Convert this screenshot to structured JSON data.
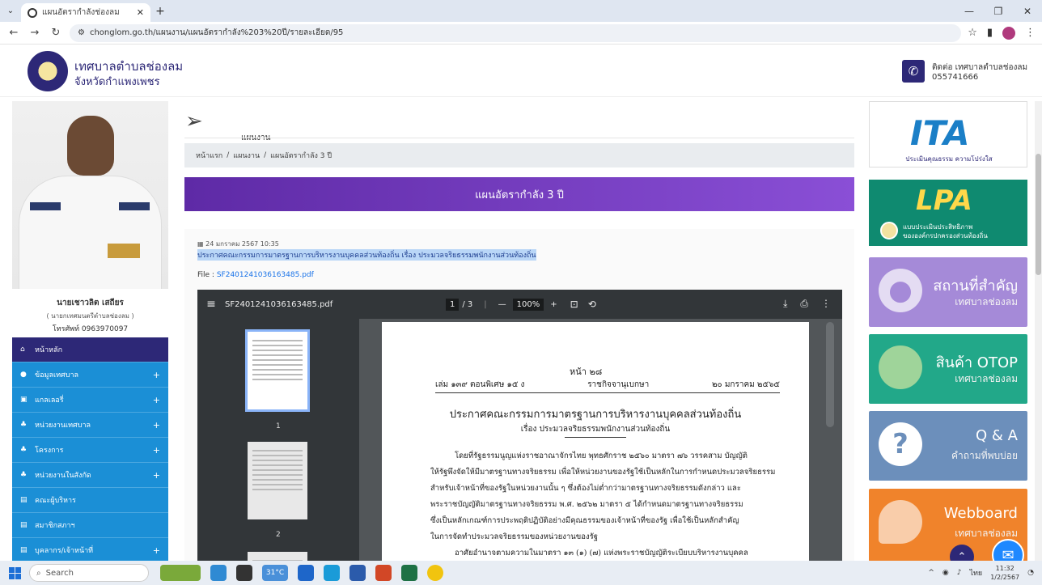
{
  "browser": {
    "tab_title": "แผนอัตรากำลังช่องลม",
    "url": "chonglom.go.th/แผนงาน/แผนอัตรากำลัง%203%20ปี/รายละเอียด/95"
  },
  "header": {
    "site_name": "เทศบาลตำบลช่องลม",
    "province": "จังหวัดกำแพงเพชร",
    "contact_line1": "ติดต่อ เทศบาลตำบลช่องลม",
    "contact_line2": "055741666"
  },
  "mayor": {
    "name": "นายเชาวลิต เสถียร",
    "position": "( นายกเทศมนตรีตำบลช่องลม )",
    "phone": "โทรศัพท์ 0963970097"
  },
  "menu": [
    {
      "icon": "home-icon",
      "label": "หน้าหลัก",
      "plus": ""
    },
    {
      "icon": "info-icon",
      "label": "ข้อมูลเทศบาล",
      "plus": "+"
    },
    {
      "icon": "gallery-icon",
      "label": "แกลเลอรี่",
      "plus": "+"
    },
    {
      "icon": "org-icon",
      "label": "หน่วยงานเทศบาล",
      "plus": "+"
    },
    {
      "icon": "org-icon",
      "label": "โครงการ",
      "plus": "+"
    },
    {
      "icon": "org-icon",
      "label": "หน่วยงานในสังกัด",
      "plus": "+"
    },
    {
      "icon": "card-icon",
      "label": "คณะผู้บริหาร",
      "plus": ""
    },
    {
      "icon": "card-icon",
      "label": "สมาชิกสภาฯ",
      "plus": ""
    },
    {
      "icon": "card-icon",
      "label": "บุคลากร/เจ้าหน้าที่",
      "plus": "+"
    }
  ],
  "content": {
    "section_title": "แผนงาน",
    "breadcrumb": [
      "หน้าแรก",
      "แผนงาน",
      "แผนอัตรากำลัง 3 ปี"
    ],
    "breadcrumb_sep": "/",
    "banner": "แผนอัตรากำลัง 3 ปี",
    "post_date": "24 มกราคม 2567 10:35",
    "post_title": "ประกาศคณะกรรมการมาตรฐานการบริหารงานบุคคลส่วนท้องถิ่น เรื่อง ประมวลจริยธรรมพนักงานส่วนท้องถิ่น",
    "file_label": "File :",
    "file_name": "SF2401241036163485.pdf"
  },
  "pdf": {
    "file_name": "SF2401241036163485.pdf",
    "page_current": "1",
    "page_total": "/ 3",
    "zoom": "100%",
    "thumb1": "1",
    "thumb2": "2",
    "doc_page": "หน้า ๒๘",
    "doc_meta_left": "เล่ม ๑๓๙ ตอนพิเศษ ๑๕ ง",
    "doc_meta_mid": "ราชกิจจานุเบกษา",
    "doc_meta_right": "๒๐ มกราคม ๒๕๖๕",
    "doc_title": "ประกาศคณะกรรมการมาตรฐานการบริหารงานบุคคลส่วนท้องถิ่น",
    "doc_subtitle": "เรื่อง ประมวลจริยธรรมพนักงานส่วนท้องถิ่น",
    "para1": [
      "โดยที่รัฐธรรมนูญแห่งราชอาณาจักรไทย พุทธศักราช ๒๕๖๐ มาตรา ๗๖ วรรคสาม บัญญัติ",
      "ให้รัฐพึงจัดให้มีมาตรฐานทางจริยธรรม เพื่อให้หน่วยงานของรัฐใช้เป็นหลักในการกำหนดประมวลจริยธรรม",
      "สำหรับเจ้าหน้าที่ของรัฐในหน่วยงานนั้น ๆ ซึ่งต้องไม่ต่ำกว่ามาตรฐานทางจริยธรรมดังกล่าว และ",
      "พระราชบัญญัติมาตรฐานทางจริยธรรม พ.ศ. ๒๕๖๒ มาตรา ๕ ได้กำหนดมาตรฐานทางจริยธรรม",
      "ซึ่งเป็นหลักเกณฑ์การประพฤติปฏิบัติอย่างมีคุณธรรมของเจ้าหน้าที่ของรัฐ เพื่อใช้เป็นหลักสำคัญ",
      "ในการจัดทำประมวลจริยธรรมของหน่วยงานของรัฐ"
    ],
    "para2": "อาศัยอำนาจตามความในมาตรา ๑๓ (๑) (๗) แห่งพระราชบัญญัติระเบียบบริหารงานบุคคล"
  },
  "right": {
    "ita_logo": "ITA",
    "ita_caption": "ประเมินคุณธรรม ความโปร่งใส",
    "lpa_logo": "LPA",
    "lpa_caption1": "แบบประเมินประสิทธิภาพ",
    "lpa_caption2": "ขององค์กรปกครองส่วนท้องถิ่น",
    "place_t1": "สถานที่สำคัญ",
    "place_t2": "เทศบาลช่องลม",
    "otop_t1": "สินค้า OTOP",
    "otop_t2": "เทศบาลช่องลม",
    "qa_t1": "Q & A",
    "qa_t2": "คำถามที่พบบ่อย",
    "web_t1": "Webboard",
    "web_t2": "เทศบาลช่องลม"
  },
  "taskbar": {
    "search": "Search",
    "weather": "31°C",
    "lang": "ไทย",
    "time": "11:32",
    "date": "1/2/2567"
  },
  "colors": {
    "brand": "#2d2877",
    "menu": "#1b8fd6",
    "banner": "#6c35b5"
  }
}
